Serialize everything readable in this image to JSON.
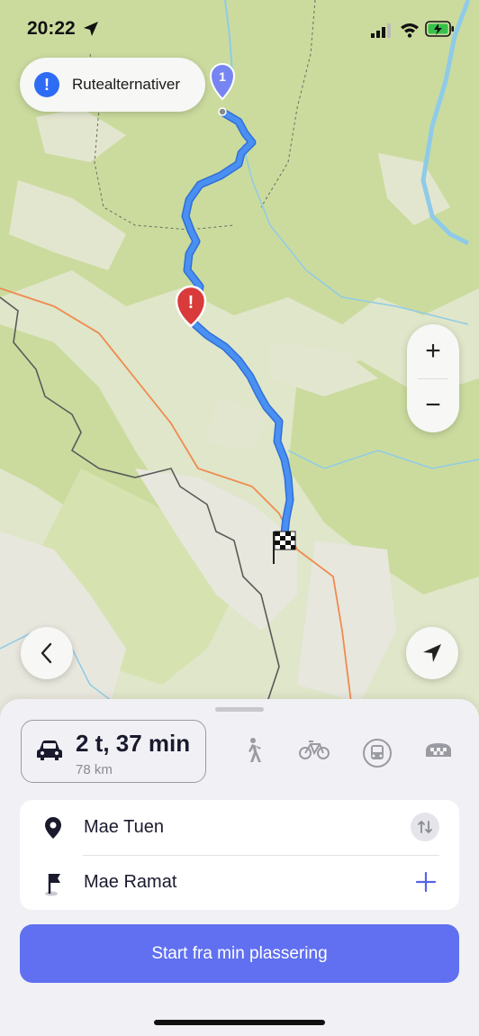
{
  "status": {
    "time": "20:22",
    "battery_color": "#36c24a"
  },
  "map": {
    "route_alternatives_label": "Rutealternativer",
    "start_marker_number": "1",
    "warning_marker": "!",
    "zoom_in": "+",
    "zoom_out": "−",
    "route_color": "#3a86f0",
    "land_color": "#d3e0a7",
    "mountain_color": "#e6e5dc"
  },
  "sheet": {
    "mode": {
      "duration": "2 t, 37 min",
      "distance": "78 km"
    },
    "transport_modes": [
      "car-icon",
      "walk-icon",
      "bike-icon",
      "transit-icon",
      "taxi-icon"
    ],
    "from": "Mae Tuen",
    "to": "Mae Ramat",
    "start_button": "Start fra min plassering"
  }
}
